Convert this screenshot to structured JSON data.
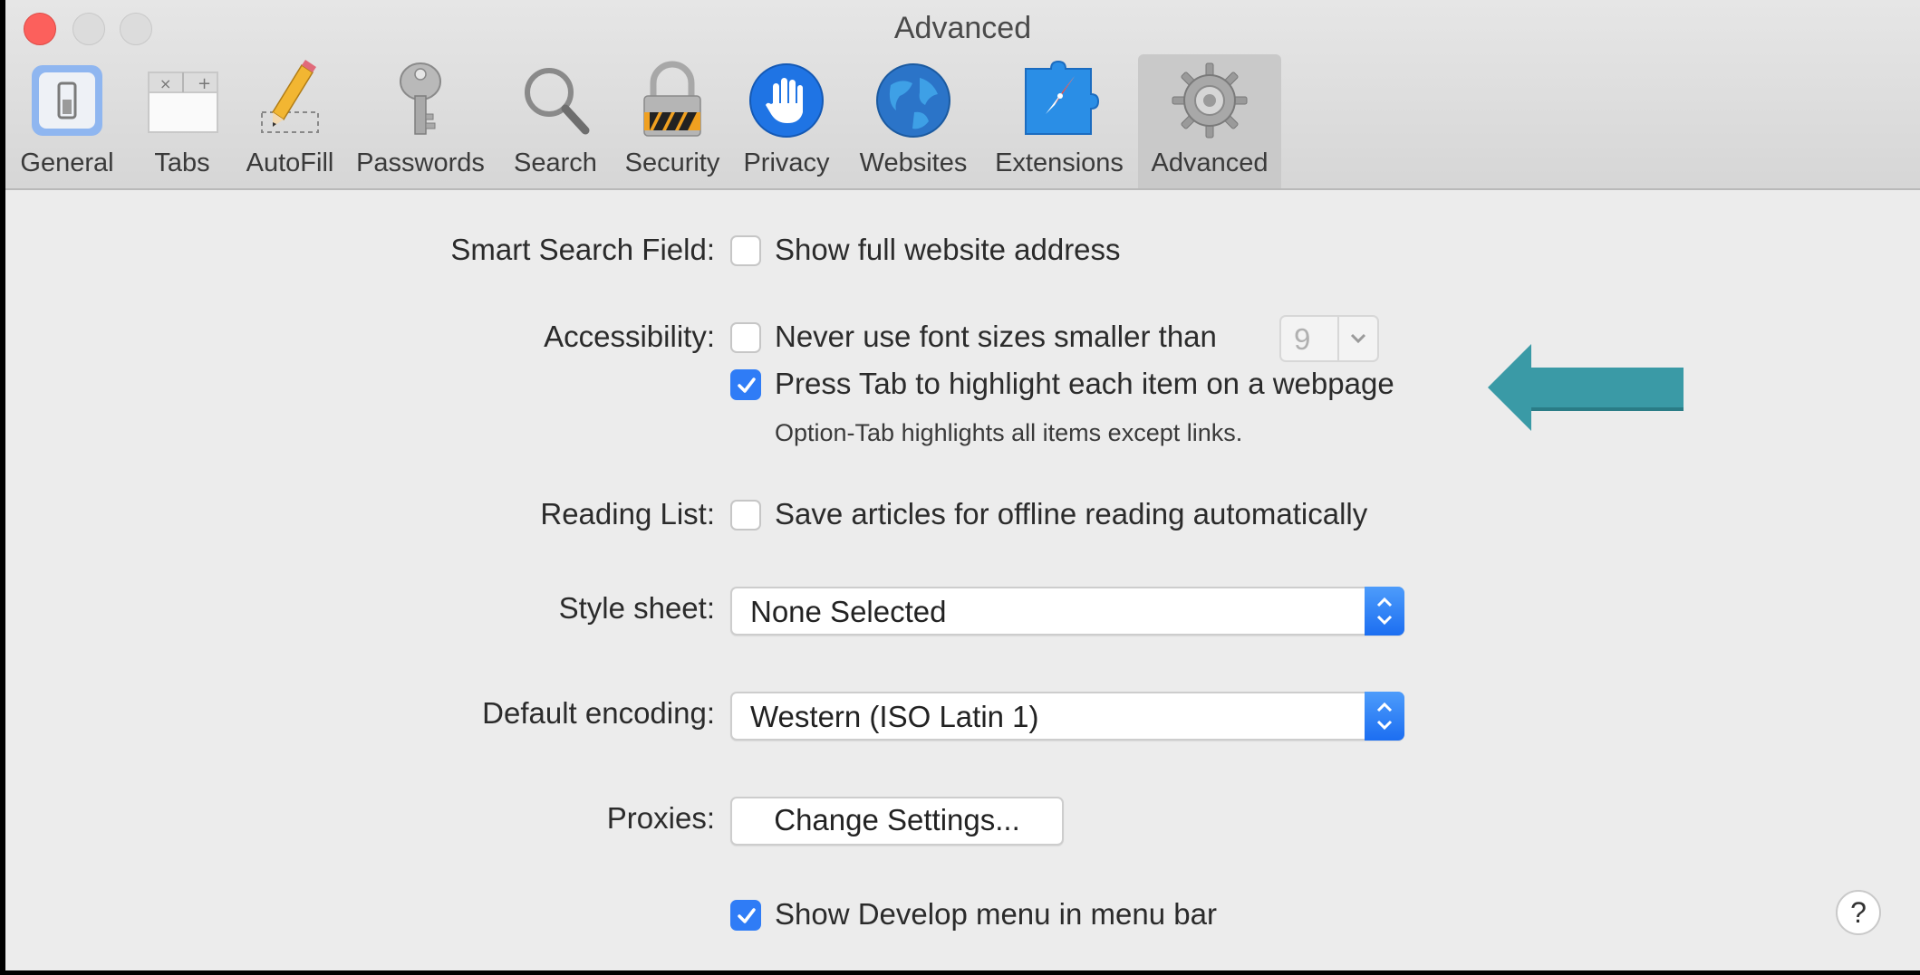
{
  "window": {
    "title": "Advanced"
  },
  "toolbar": [
    {
      "label": "General",
      "icon": "general-switch-icon"
    },
    {
      "label": "Tabs",
      "icon": "tabs-icon"
    },
    {
      "label": "AutoFill",
      "icon": "pencil-icon"
    },
    {
      "label": "Passwords",
      "icon": "key-icon"
    },
    {
      "label": "Search",
      "icon": "magnifier-icon"
    },
    {
      "label": "Security",
      "icon": "padlock-icon"
    },
    {
      "label": "Privacy",
      "icon": "hand-icon"
    },
    {
      "label": "Websites",
      "icon": "globe-icon"
    },
    {
      "label": "Extensions",
      "icon": "puzzle-compass-icon"
    },
    {
      "label": "Advanced",
      "icon": "gear-icon",
      "selected": true
    }
  ],
  "settings": {
    "smart_search": {
      "label": "Smart Search Field:",
      "option": "Show full website address",
      "checked": false
    },
    "accessibility": {
      "label": "Accessibility:",
      "font_option": "Never use font sizes smaller than",
      "font_checked": false,
      "font_size": "9",
      "tab_option": "Press Tab to highlight each item on a webpage",
      "tab_checked": true,
      "tab_note": "Option-Tab highlights all items except links."
    },
    "reading_list": {
      "label": "Reading List:",
      "option": "Save articles for offline reading automatically",
      "checked": false
    },
    "style_sheet": {
      "label": "Style sheet:",
      "value": "None Selected"
    },
    "encoding": {
      "label": "Default encoding:",
      "value": "Western (ISO Latin 1)"
    },
    "proxies": {
      "label": "Proxies:",
      "button": "Change Settings..."
    },
    "develop": {
      "option": "Show Develop menu in menu bar",
      "checked": true
    }
  },
  "help_button": "?",
  "colors": {
    "accent": "#2f7cf6",
    "arrow": "#3a9aa6",
    "close": "#fc605c"
  }
}
